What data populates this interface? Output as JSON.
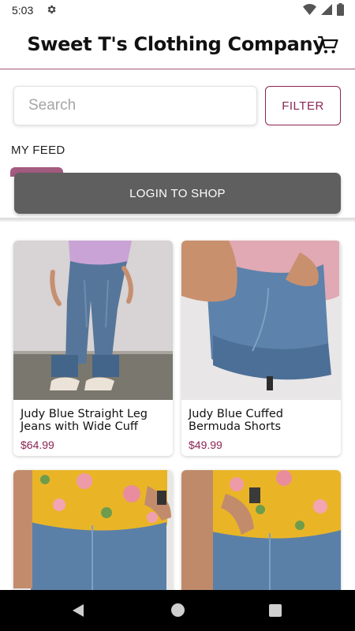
{
  "status_bar": {
    "time": "5:03",
    "icons": [
      "settings-icon",
      "wifi-icon",
      "signal-icon",
      "battery-icon"
    ]
  },
  "header": {
    "title": "Sweet T's Clothing Company",
    "cart_icon": "cart-icon"
  },
  "search": {
    "placeholder": "Search",
    "value": "",
    "filter_label": "FILTER"
  },
  "tabs": [
    {
      "label": "MY FEED",
      "active": true
    }
  ],
  "login_button": {
    "label": "LOGIN TO SHOP"
  },
  "products": [
    {
      "name": "Judy Blue Straight Leg Jeans with Wide Cuff",
      "price": "$64.99",
      "image": "straight-leg-jeans-photo"
    },
    {
      "name": "Judy Blue Cuffed Bermuda Shorts",
      "price": "$49.99",
      "image": "bermuda-shorts-photo"
    },
    {
      "name": "",
      "price": "",
      "image": "floral-top-denim-shorts-photo"
    },
    {
      "name": "",
      "price": "",
      "image": "floral-top-denim-shorts-photo-2"
    }
  ],
  "nav_bar": {
    "icons": [
      "back-icon",
      "home-icon",
      "recents-icon"
    ]
  },
  "colors": {
    "accent": "#8b2455",
    "header_rule": "#9c5a78",
    "login_button_bg": "#5f5f5f",
    "tab_indicator": "#a35b7f"
  }
}
